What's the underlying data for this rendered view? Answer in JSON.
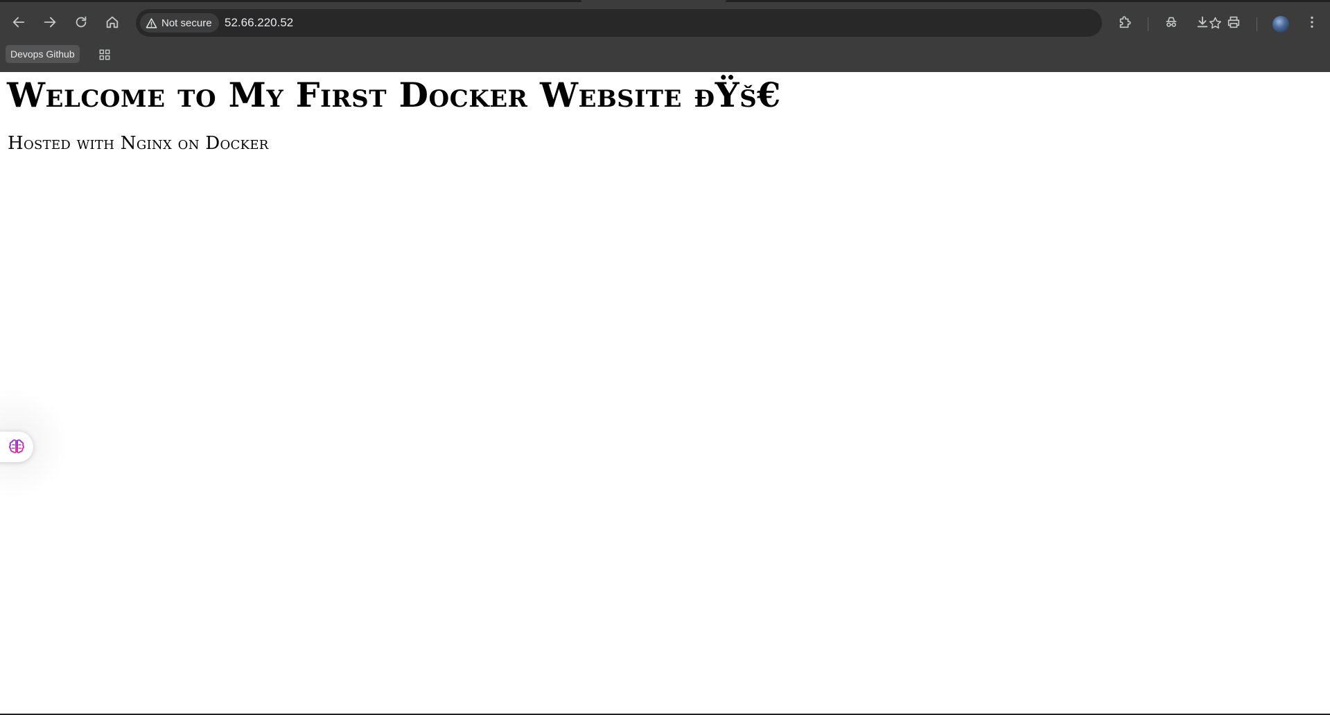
{
  "browser": {
    "security_label": "Not secure",
    "url": "52.66.220.52",
    "bookmarks": [
      {
        "label": "Devops Github"
      }
    ],
    "colors": {
      "chrome_bg": "#3c3c3c",
      "omnibox_bg": "#282828",
      "text": "#e8eaed"
    },
    "icons": {
      "back": "arrow-left-icon",
      "forward": "arrow-right-icon",
      "reload": "reload-icon",
      "home": "home-icon",
      "warning": "warning-triangle-icon",
      "star": "star-icon",
      "extensions": "puzzle-icon",
      "incognito": "incognito-icon",
      "download": "download-icon",
      "print": "print-icon",
      "menu": "more-vertical-icon",
      "apps": "apps-grid-icon"
    }
  },
  "page": {
    "heading": "Welcome to My First Docker Website ðŸš€",
    "subheading": "Hosted with Nginx on Docker"
  },
  "extension_widget": {
    "icon": "brain-icon"
  }
}
